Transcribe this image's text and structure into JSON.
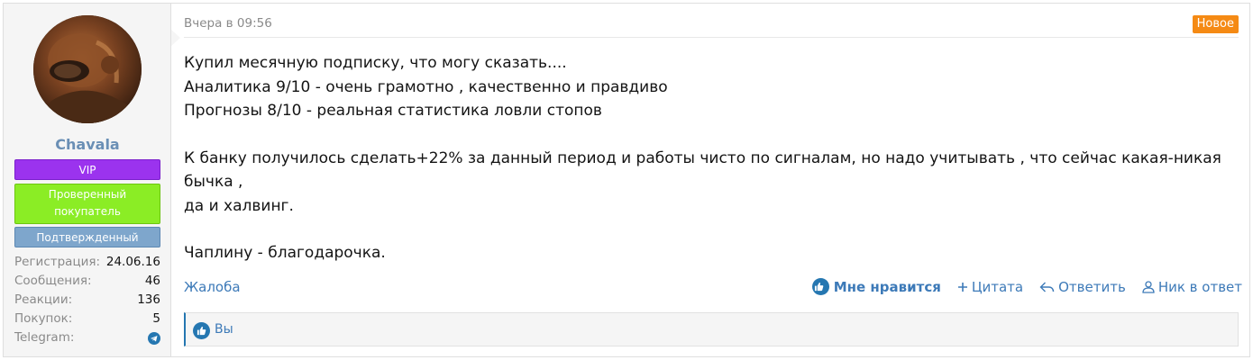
{
  "author": {
    "username": "Chavala",
    "badges": {
      "vip": "VIP",
      "verified_buyer_line1": "Проверенный",
      "verified_buyer_line2": "покупатель",
      "confirmed": "Подтвержденный"
    },
    "stats": [
      {
        "label": "Регистрация:",
        "value": "24.06.16"
      },
      {
        "label": "Сообщения:",
        "value": "46"
      },
      {
        "label": "Реакции:",
        "value": "136"
      },
      {
        "label": "Покупок:",
        "value": "5"
      },
      {
        "label": "Telegram:",
        "icon": "telegram-icon"
      }
    ]
  },
  "post": {
    "date": "Вчера в 09:56",
    "new_label": "Новое",
    "lines": [
      "Купил месячную подписку, что могу сказать....",
      "Аналитика 9/10 - очень грамотно , качественно и правдиво",
      "Прогнозы 8/10 - реальная статистика ловли стопов",
      "К банку получилось сделать+22% за данный период и работы чисто по сигналам, но надо учитывать , что сейчас какая-никая бычка ,",
      "да и халвинг.",
      "Чаплину - благодарочка."
    ]
  },
  "footer": {
    "report": "Жалоба",
    "like": "Мне нравится",
    "quote": "Цитата",
    "reply": "Ответить",
    "mention": "Ник в ответ"
  },
  "likes": {
    "text": "Вы"
  },
  "colors": {
    "accent": "#2577b1",
    "username": "#6a8fb5",
    "vip": "#9b33ee",
    "verified_buyer": "#8bed25",
    "confirmed": "#7ea6cc",
    "new_badge": "#f58a14"
  }
}
